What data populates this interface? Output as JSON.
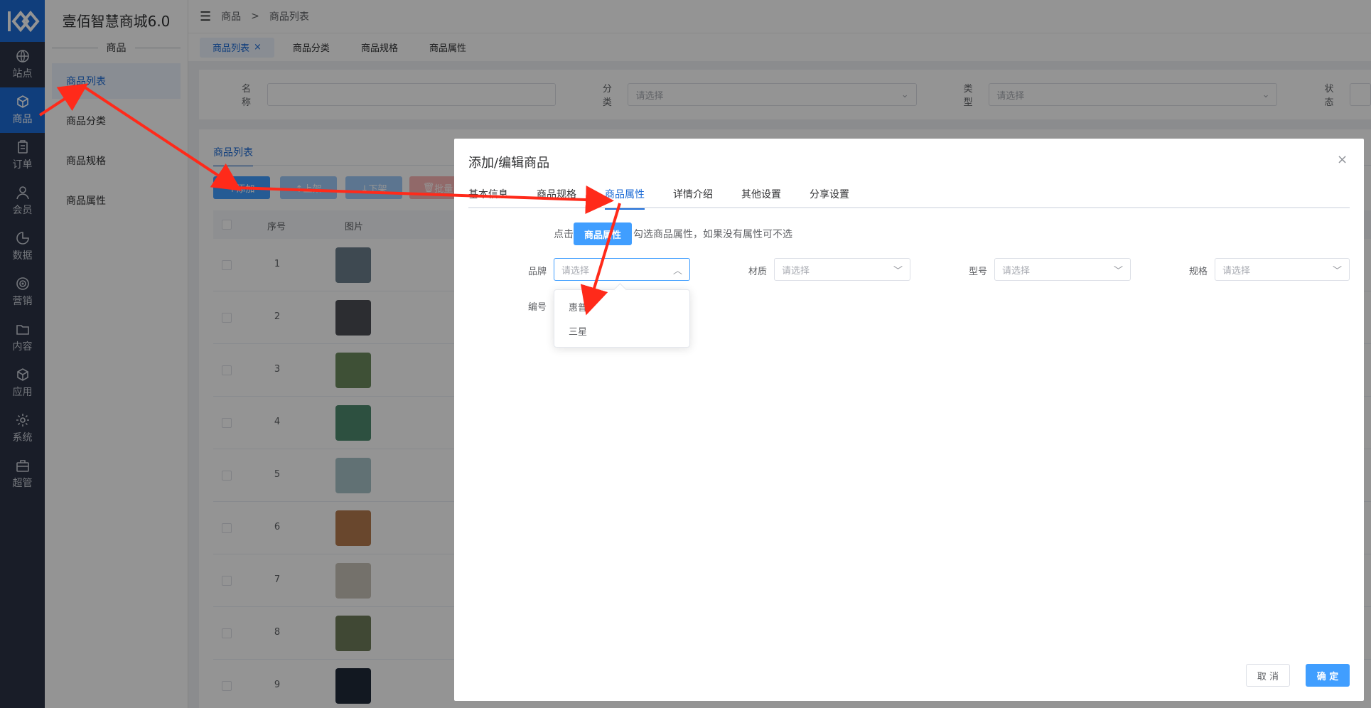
{
  "rail": {
    "items": [
      {
        "label": "站点",
        "icon": "globe-icon"
      },
      {
        "label": "商品",
        "icon": "box-icon",
        "active": true
      },
      {
        "label": "订单",
        "icon": "clipboard-icon"
      },
      {
        "label": "会员",
        "icon": "user-icon"
      },
      {
        "label": "数据",
        "icon": "pie-chart-icon"
      },
      {
        "label": "营销",
        "icon": "target-icon"
      },
      {
        "label": "内容",
        "icon": "folder-icon"
      },
      {
        "label": "应用",
        "icon": "cube-icon"
      },
      {
        "label": "系统",
        "icon": "gear-icon"
      },
      {
        "label": "超管",
        "icon": "briefcase-icon"
      }
    ]
  },
  "submenu": {
    "brand": "壹佰智慧商城6.0",
    "group": "商品",
    "items": [
      "商品列表",
      "商品分类",
      "商品规格",
      "商品属性"
    ]
  },
  "topbar": {
    "crumb_root": "商品",
    "crumb_sep": ">",
    "crumb_current": "商品列表"
  },
  "tabs": [
    "商品列表",
    "商品分类",
    "商品规格",
    "商品属性"
  ],
  "filter": {
    "name_label": "名称",
    "category_label": "分类",
    "type_label": "类型",
    "status_label": "状态",
    "placeholder": "请选择"
  },
  "list": {
    "tab": "商品列表",
    "add_btn": "+添加",
    "up_btn": "↑上架",
    "down_btn": "↓下架",
    "batch_btn": "批量",
    "col_index": "序号",
    "col_image": "图片",
    "rows": [
      "1",
      "2",
      "3",
      "4",
      "5",
      "6",
      "7",
      "8",
      "9"
    ]
  },
  "dialog": {
    "title": "添加/编辑商品",
    "tabs": [
      "基本信息",
      "商品规格",
      "商品属性",
      "详情介绍",
      "其他设置",
      "分享设置"
    ],
    "active_tab": "商品属性",
    "hint_prefix": "点击",
    "hint_button": "商品属性",
    "hint_suffix": "勾选商品属性，如果没有属性可不选",
    "fields": {
      "brand": "品牌",
      "material": "材质",
      "model": "型号",
      "spec": "规格",
      "code": "编号",
      "placeholder": "请选择"
    },
    "brand_options": [
      "惠普",
      "三星"
    ],
    "cancel": "取 消",
    "ok": "确 定"
  },
  "colors": {
    "primary": "#409eff",
    "accent": "#1c6bd6",
    "annotation": "#ff2a1a"
  }
}
